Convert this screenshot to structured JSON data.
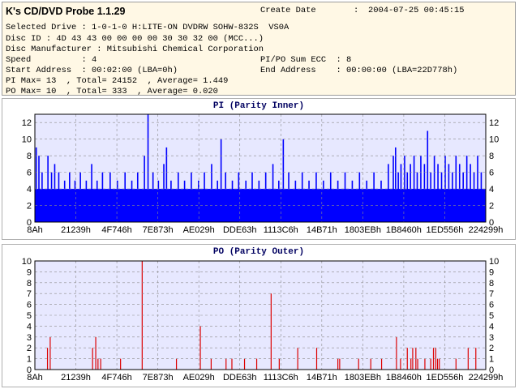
{
  "app": {
    "title": "K's CD/DVD Probe 1.1.29"
  },
  "info": {
    "create_date_label": "Create Date",
    "create_date_sep": ":",
    "create_date_value": "2004-07-25 00:45:15",
    "selected_drive": "Selected Drive : 1-0-1-0 H:LITE-ON DVDRW SOHW-832S  VS0A",
    "disc_id": "Disc ID : 4D 43 43 00 00 00 00 30 30 32 00 (MCC...)",
    "disc_manufacturer": "Disc Manufacturer : Mitsubishi Chemical Corporation",
    "speed": "Speed          : 4",
    "ecc": "PI/PO Sum ECC  : 8",
    "start_address": "Start Address  : 00:02:00 (LBA=0h)",
    "end_address": "End Address    : 00:00:00 (LBA=22D778h)",
    "pi_stats": "PI Max= 13  , Total= 24152  , Average= 1.449",
    "po_stats": "PO Max= 10  , Total= 333  , Average= 0.020"
  },
  "colors": {
    "pi_fill": "#0000ff",
    "po_line": "#dd0000",
    "plot_bg": "#e7e8ff",
    "grid": "#8c8c8c"
  },
  "chart_data": [
    {
      "type": "bar",
      "title": "PI (Parity Inner)",
      "categories": [
        "8Ah",
        "21239h",
        "4F746h",
        "7E873h",
        "AE029h",
        "DDE63h",
        "1113C6h",
        "14B71h",
        "1803EBh",
        "1B8460h",
        "1ED556h",
        "224299h"
      ],
      "ylim": [
        0,
        13
      ],
      "yticks": [
        0,
        2,
        4,
        6,
        8,
        10,
        12
      ],
      "grid": true,
      "baseline": 4,
      "peaks": [
        [
          0.003,
          9
        ],
        [
          0.009,
          8
        ],
        [
          0.016,
          6
        ],
        [
          0.029,
          8
        ],
        [
          0.037,
          6
        ],
        [
          0.044,
          7
        ],
        [
          0.053,
          6
        ],
        [
          0.066,
          5
        ],
        [
          0.077,
          6
        ],
        [
          0.089,
          5
        ],
        [
          0.101,
          6
        ],
        [
          0.114,
          5
        ],
        [
          0.126,
          7
        ],
        [
          0.138,
          5
        ],
        [
          0.15,
          6
        ],
        [
          0.167,
          6
        ],
        [
          0.183,
          5
        ],
        [
          0.2,
          6
        ],
        [
          0.215,
          5
        ],
        [
          0.228,
          6
        ],
        [
          0.243,
          8
        ],
        [
          0.251,
          13
        ],
        [
          0.262,
          6
        ],
        [
          0.274,
          5
        ],
        [
          0.286,
          7
        ],
        [
          0.292,
          9
        ],
        [
          0.302,
          5
        ],
        [
          0.318,
          6
        ],
        [
          0.332,
          5
        ],
        [
          0.347,
          6
        ],
        [
          0.363,
          5
        ],
        [
          0.376,
          6
        ],
        [
          0.392,
          7
        ],
        [
          0.405,
          5
        ],
        [
          0.413,
          10
        ],
        [
          0.423,
          6
        ],
        [
          0.438,
          5
        ],
        [
          0.452,
          6
        ],
        [
          0.468,
          5
        ],
        [
          0.482,
          6
        ],
        [
          0.497,
          5
        ],
        [
          0.512,
          6
        ],
        [
          0.528,
          7
        ],
        [
          0.541,
          5
        ],
        [
          0.551,
          10
        ],
        [
          0.563,
          6
        ],
        [
          0.578,
          5
        ],
        [
          0.593,
          6
        ],
        [
          0.608,
          5
        ],
        [
          0.624,
          6
        ],
        [
          0.64,
          5
        ],
        [
          0.656,
          6
        ],
        [
          0.672,
          5
        ],
        [
          0.688,
          6
        ],
        [
          0.704,
          5
        ],
        [
          0.72,
          6
        ],
        [
          0.736,
          5
        ],
        [
          0.752,
          6
        ],
        [
          0.768,
          5
        ],
        [
          0.784,
          7
        ],
        [
          0.795,
          8
        ],
        [
          0.8,
          9
        ],
        [
          0.806,
          6
        ],
        [
          0.812,
          7
        ],
        [
          0.82,
          8
        ],
        [
          0.826,
          6
        ],
        [
          0.833,
          7
        ],
        [
          0.841,
          8
        ],
        [
          0.848,
          6
        ],
        [
          0.856,
          8
        ],
        [
          0.864,
          7
        ],
        [
          0.871,
          11
        ],
        [
          0.878,
          6
        ],
        [
          0.886,
          8
        ],
        [
          0.894,
          7
        ],
        [
          0.902,
          6
        ],
        [
          0.91,
          8
        ],
        [
          0.918,
          7
        ],
        [
          0.926,
          6
        ],
        [
          0.934,
          8
        ],
        [
          0.942,
          7
        ],
        [
          0.95,
          6
        ],
        [
          0.958,
          8
        ],
        [
          0.966,
          7
        ],
        [
          0.974,
          6
        ],
        [
          0.982,
          8
        ],
        [
          0.99,
          6
        ]
      ]
    },
    {
      "type": "bar",
      "title": "PO (Parity Outer)",
      "categories": [
        "8Ah",
        "21239h",
        "4F746h",
        "7E873h",
        "AE029h",
        "DDE63h",
        "1113C6h",
        "14B71h",
        "1803EBh",
        "1B8460h",
        "1ED556h",
        "224299h"
      ],
      "ylim": [
        0,
        10
      ],
      "yticks": [
        0,
        1,
        2,
        3,
        4,
        5,
        6,
        7,
        8,
        9,
        10
      ],
      "grid": true,
      "peaks": [
        [
          0.028,
          2
        ],
        [
          0.034,
          3
        ],
        [
          0.128,
          2
        ],
        [
          0.135,
          3
        ],
        [
          0.14,
          1
        ],
        [
          0.146,
          1
        ],
        [
          0.19,
          1
        ],
        [
          0.238,
          10
        ],
        [
          0.314,
          1
        ],
        [
          0.367,
          4
        ],
        [
          0.391,
          1
        ],
        [
          0.424,
          1
        ],
        [
          0.437,
          1
        ],
        [
          0.465,
          1
        ],
        [
          0.492,
          1
        ],
        [
          0.524,
          7
        ],
        [
          0.542,
          1
        ],
        [
          0.583,
          2
        ],
        [
          0.625,
          2
        ],
        [
          0.672,
          1
        ],
        [
          0.676,
          1
        ],
        [
          0.718,
          1
        ],
        [
          0.745,
          1
        ],
        [
          0.769,
          1
        ],
        [
          0.802,
          3
        ],
        [
          0.811,
          1
        ],
        [
          0.826,
          2
        ],
        [
          0.834,
          1
        ],
        [
          0.838,
          2
        ],
        [
          0.845,
          2
        ],
        [
          0.849,
          1
        ],
        [
          0.865,
          1
        ],
        [
          0.878,
          1
        ],
        [
          0.884,
          2
        ],
        [
          0.889,
          2
        ],
        [
          0.893,
          1
        ],
        [
          0.897,
          1
        ],
        [
          0.934,
          1
        ],
        [
          0.961,
          2
        ],
        [
          0.978,
          2
        ]
      ]
    }
  ]
}
